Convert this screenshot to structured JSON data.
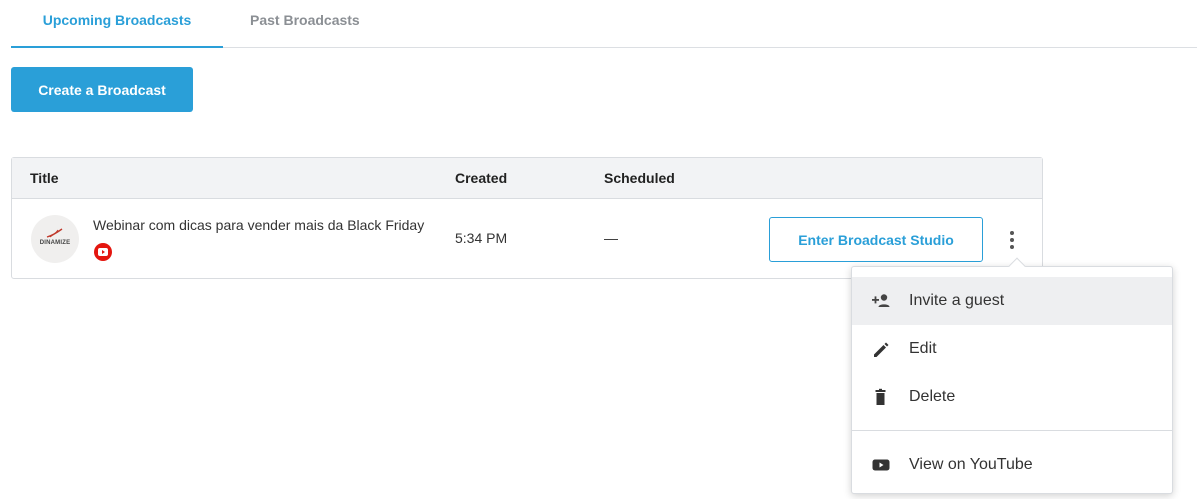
{
  "tabs": [
    {
      "label": "Upcoming Broadcasts",
      "active": true
    },
    {
      "label": "Past Broadcasts",
      "active": false
    }
  ],
  "create_button": {
    "label": "Create a Broadcast"
  },
  "table": {
    "headers": {
      "title": "Title",
      "created": "Created",
      "scheduled": "Scheduled"
    },
    "rows": [
      {
        "logo_text": "DINAMIZE",
        "title": "Webinar com dicas para vender mais da Black Friday",
        "destination_icon": "youtube-icon",
        "created": "5:34 PM",
        "scheduled": "—",
        "action_label": "Enter Broadcast Studio"
      }
    ]
  },
  "menu": {
    "items": [
      {
        "label": "Invite a guest",
        "icon": "add-person-icon"
      },
      {
        "label": "Edit",
        "icon": "pencil-icon"
      },
      {
        "label": "Delete",
        "icon": "trash-icon"
      },
      {
        "label": "View on YouTube",
        "icon": "youtube-icon"
      }
    ]
  },
  "colors": {
    "accent": "#2a9fd8",
    "youtube_red": "#e4160f",
    "header_bg": "#f2f3f5",
    "hover_bg": "#eeeff1"
  }
}
